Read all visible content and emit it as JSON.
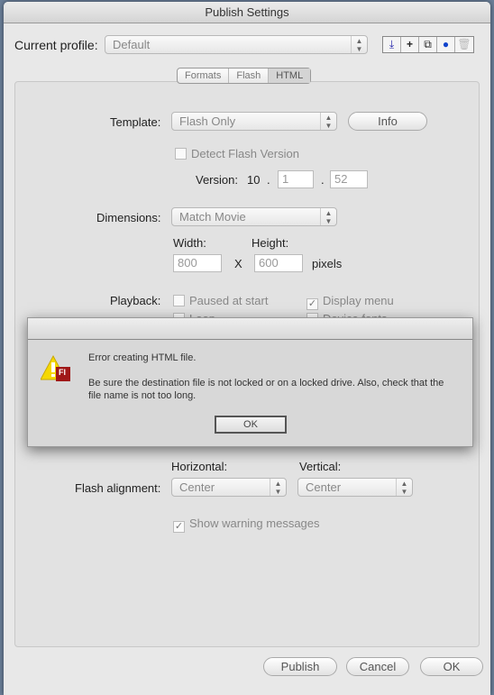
{
  "window": {
    "title": "Publish Settings"
  },
  "profile": {
    "label": "Current profile:",
    "value": "Default"
  },
  "toolbar": {
    "icons": [
      "import-export-icon",
      "add-icon",
      "duplicate-icon",
      "info-icon",
      "trash-icon"
    ]
  },
  "tabs": [
    {
      "label": "Formats"
    },
    {
      "label": "Flash"
    },
    {
      "label": "HTML",
      "selected": true
    }
  ],
  "html": {
    "template_label": "Template:",
    "template_value": "Flash Only",
    "info_button": "Info",
    "detect_label": "Detect Flash Version",
    "detect_checked": false,
    "version_label": "Version:",
    "version_major": "10",
    "version_minor": "1",
    "version_rev": "52",
    "dot": ".",
    "dimensions_label": "Dimensions:",
    "dimensions_value": "Match Movie",
    "width_label": "Width:",
    "width_value": "800",
    "x": "X",
    "height_label": "Height:",
    "height_value": "600",
    "pixels": "pixels",
    "playback_label": "Playback:",
    "paused_label": "Paused at start",
    "paused_checked": false,
    "display_menu_label": "Display menu",
    "display_menu_checked": true,
    "loop_label": "Loop",
    "device_fonts_label": "Device fonts",
    "horizontal_label": "Horizontal:",
    "vertical_label": "Vertical:",
    "alignment_label": "Flash alignment:",
    "horizontal_value": "Center",
    "vertical_value": "Center",
    "warnings_label": "Show warning messages",
    "warnings_checked": true
  },
  "footer": {
    "publish": "Publish",
    "cancel": "Cancel",
    "ok": "OK"
  },
  "dialog": {
    "title": "Error creating HTML file.",
    "message": "Be sure the destination file is not locked or on a locked drive. Also, check that the file name is not too long.",
    "ok": "OK",
    "icon_badge": "Fl"
  }
}
